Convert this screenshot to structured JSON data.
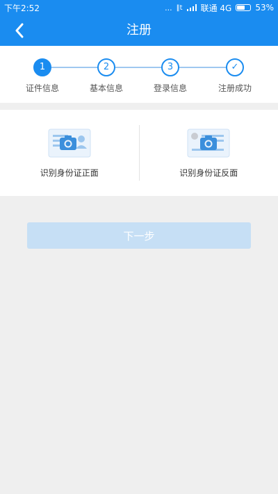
{
  "status_bar": {
    "time": "下午2:52",
    "carrier": "联通 4G",
    "battery": "53%",
    "dots": "...",
    "network": "‖t"
  },
  "nav": {
    "title": "注册"
  },
  "steps": [
    {
      "marker": "1",
      "label": "证件信息",
      "active": true
    },
    {
      "marker": "2",
      "label": "基本信息",
      "active": false
    },
    {
      "marker": "3",
      "label": "登录信息",
      "active": false
    },
    {
      "marker": "✓",
      "label": "注册成功",
      "active": false
    }
  ],
  "id_cards": {
    "front_label": "识别身份证正面",
    "back_label": "识别身份证反面"
  },
  "next_button": {
    "label": "下一步"
  },
  "colors": {
    "primary": "#1a8cf0",
    "button_disabled": "#c6dff5",
    "background": "#efefef"
  }
}
